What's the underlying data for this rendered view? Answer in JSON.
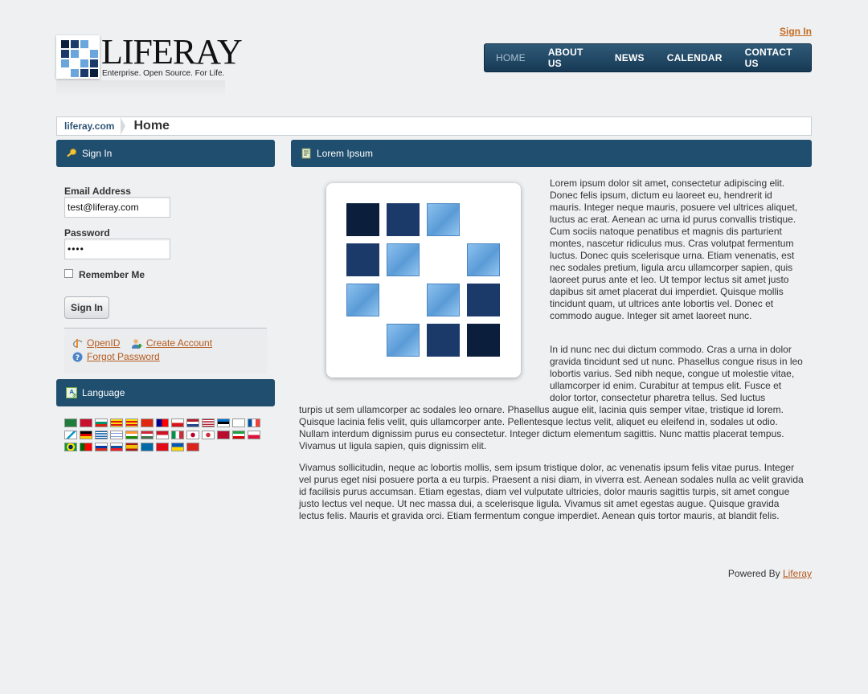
{
  "header": {
    "logo_word": "LIFERAY",
    "logo_tagline": "Enterprise. Open Source. For Life.",
    "sign_in_link": "Sign In",
    "nav": [
      {
        "label": "HOME",
        "active": true
      },
      {
        "label": "ABOUT US"
      },
      {
        "label": "NEWS"
      },
      {
        "label": "CALENDAR"
      },
      {
        "label": "CONTACT US"
      }
    ]
  },
  "breadcrumb": {
    "first": "liferay.com",
    "current": "Home"
  },
  "signin_portlet": {
    "title": "Sign In",
    "email_label": "Email Address",
    "email_value": "test@liferay.com",
    "password_label": "Password",
    "password_value": "••••",
    "remember_label": "Remember Me",
    "button_label": "Sign In",
    "links": {
      "openid": "OpenID",
      "create_account": "Create Account",
      "forgot_password": "Forgot Password"
    }
  },
  "language_portlet": {
    "title": "Language",
    "flag_count": 42
  },
  "content_portlet": {
    "title": "Lorem Ipsum",
    "p1a": "Lorem ipsum dolor sit amet, consectetur adipiscing elit. Donec felis ipsum, dictum eu laoreet eu, hendrerit id mauris. Integer neque mauris, posuere vel ultrices aliquet, luctus ac erat. Aenean ac urna id purus convallis tristique. Cum sociis natoque penatibus et magnis dis parturient montes, nascetur ridiculus mus. Cras volutpat fermentum luctus. Donec quis scelerisque urna. Etiam venenatis, est nec sodales pretium, ligula arcu ullamcorper sapien, quis laoreet purus ante et leo. Ut tempor lectus sit amet justo dapibus sit amet placerat dui imperdiet. Quisque mollis tincidunt quam, ut ultrices ante lobortis vel. Donec et commodo augue. Integer sit amet laoreet nunc.",
    "p2a": "In id nunc nec dui dictum commodo. Cras a urna in dolor gravida tincidunt sed ut nunc. Phasellus congue risus in leo lobortis varius. Sed nibh neque, congue ut molestie vitae, ullamcorper id enim. Curabitur at tempus elit. Fusce et dolor tortor, consectetur pharetra tellus. Sed luctus",
    "p2b": "turpis ut sem ullamcorper ac sodales leo ornare. Phasellus augue elit, lacinia quis semper vitae, tristique id lorem. Quisque lacinia felis velit, quis ullamcorper ante. Pellentesque lectus velit, aliquet eu eleifend in, sodales ut odio. Nullam interdum dignissim purus eu consectetur. Integer dictum elementum sagittis. Nunc mattis placerat tempus. Vivamus ut ligula sapien, quis dignissim elit.",
    "p3": "Vivamus sollicitudin, neque ac lobortis mollis, sem ipsum tristique dolor, ac venenatis ipsum felis vitae purus. Integer vel purus eget nisi posuere porta a eu turpis. Praesent a nisi diam, in viverra est. Aenean sodales nulla ac velit gravida id facilisis purus accumsan. Etiam egestas, diam vel vulputate ultricies, dolor mauris sagittis turpis, sit amet congue justo lectus vel neque. Ut nec massa dui, a scelerisque ligula. Vivamus sit amet egestas augue. Quisque gravida lectus felis. Mauris et gravida orci. Etiam fermentum congue imperdiet. Aenean quis tortor mauris, at blandit felis."
  },
  "footer": {
    "powered_by": "Powered By",
    "link": "Liferay"
  },
  "colors": {
    "nav_bg": "#1f4e6e",
    "link": "#b65a1c",
    "page_bg": "#eef0f2"
  }
}
